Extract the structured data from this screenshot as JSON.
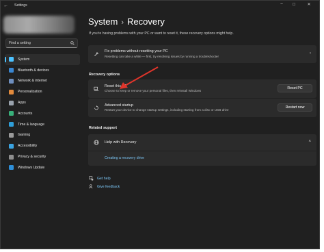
{
  "window": {
    "title": "Settings",
    "back_glyph": "←",
    "controls": {
      "minimize": "–",
      "maximize": "☐",
      "close": "✕"
    }
  },
  "search": {
    "placeholder": "Find a setting",
    "value": "Find a setting",
    "icon": "search-icon"
  },
  "sidebar": {
    "items": [
      {
        "label": "System",
        "icon": "system-icon",
        "color": "#4cc2ff",
        "active": true
      },
      {
        "label": "Bluetooth & devices",
        "icon": "bluetooth-icon",
        "color": "#3a86d1"
      },
      {
        "label": "Network & internet",
        "icon": "wifi-icon",
        "color": "#6f8fbf"
      },
      {
        "label": "Personalization",
        "icon": "brush-icon",
        "color": "#e28a3c"
      },
      {
        "label": "Apps",
        "icon": "apps-icon",
        "color": "#9aa3ad"
      },
      {
        "label": "Accounts",
        "icon": "person-icon",
        "color": "#38b07a"
      },
      {
        "label": "Time & language",
        "icon": "globe-clock-icon",
        "color": "#2f9ed8"
      },
      {
        "label": "Gaming",
        "icon": "controller-icon",
        "color": "#9a9a9a"
      },
      {
        "label": "Accessibility",
        "icon": "accessibility-icon",
        "color": "#3aa3e0"
      },
      {
        "label": "Privacy & security",
        "icon": "shield-icon",
        "color": "#8f8f8f"
      },
      {
        "label": "Windows Update",
        "icon": "update-icon",
        "color": "#2e8fd8"
      }
    ]
  },
  "header": {
    "breadcrumb_parent": "System",
    "separator": "›",
    "title": "Recovery"
  },
  "description": "If you're having problems with your PC or want to reset it, these recovery options might help.",
  "fix_card": {
    "title": "Fix problems without resetting your PC",
    "subtitle": "Resetting can take a while — first, try resolving issues by running a troubleshooter",
    "chevron": "›"
  },
  "recovery_options": {
    "heading": "Recovery options",
    "reset": {
      "title": "Reset this PC",
      "subtitle": "Choose to keep or remove your personal files, then reinstall Windows",
      "button": "Reset PC"
    },
    "advanced": {
      "title": "Advanced startup",
      "subtitle": "Restart your device to change startup settings, including starting from a disc or USB drive",
      "button": "Restart now"
    }
  },
  "related_support": {
    "heading": "Related support",
    "help_title": "Help with Recovery",
    "chevron": "˄",
    "link": "Creating a recovery drive"
  },
  "footer": {
    "get_help": "Get help",
    "give_feedback": "Give feedback"
  },
  "colors": {
    "accent": "#4cc2ff",
    "link": "#7cc6f5",
    "annotation_arrow": "#e0352b"
  }
}
